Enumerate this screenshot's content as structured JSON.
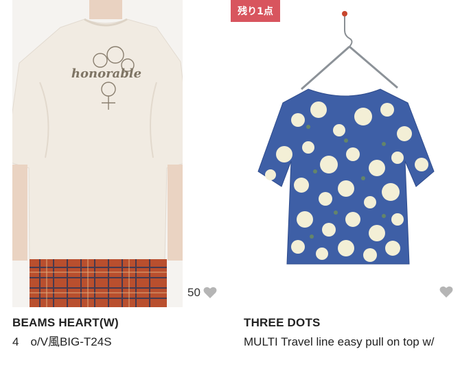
{
  "products": [
    {
      "brand": "BEAMS HEART(W)",
      "name": "4　o/V風BIG-T24S",
      "like_count": "50",
      "shirt_print": "honorable"
    },
    {
      "badge": "残り1点",
      "brand": "THREE DOTS",
      "name": "MULTI Travel line easy pull on top w/",
      "like_count": ""
    }
  ],
  "colors": {
    "badge_bg": "#d8555e",
    "heart": "#b5b5b5",
    "shirt_1": "#f1ebe2",
    "shirt_2_base": "#3e5fa6",
    "shirt_2_flower": "#f3efd6"
  }
}
